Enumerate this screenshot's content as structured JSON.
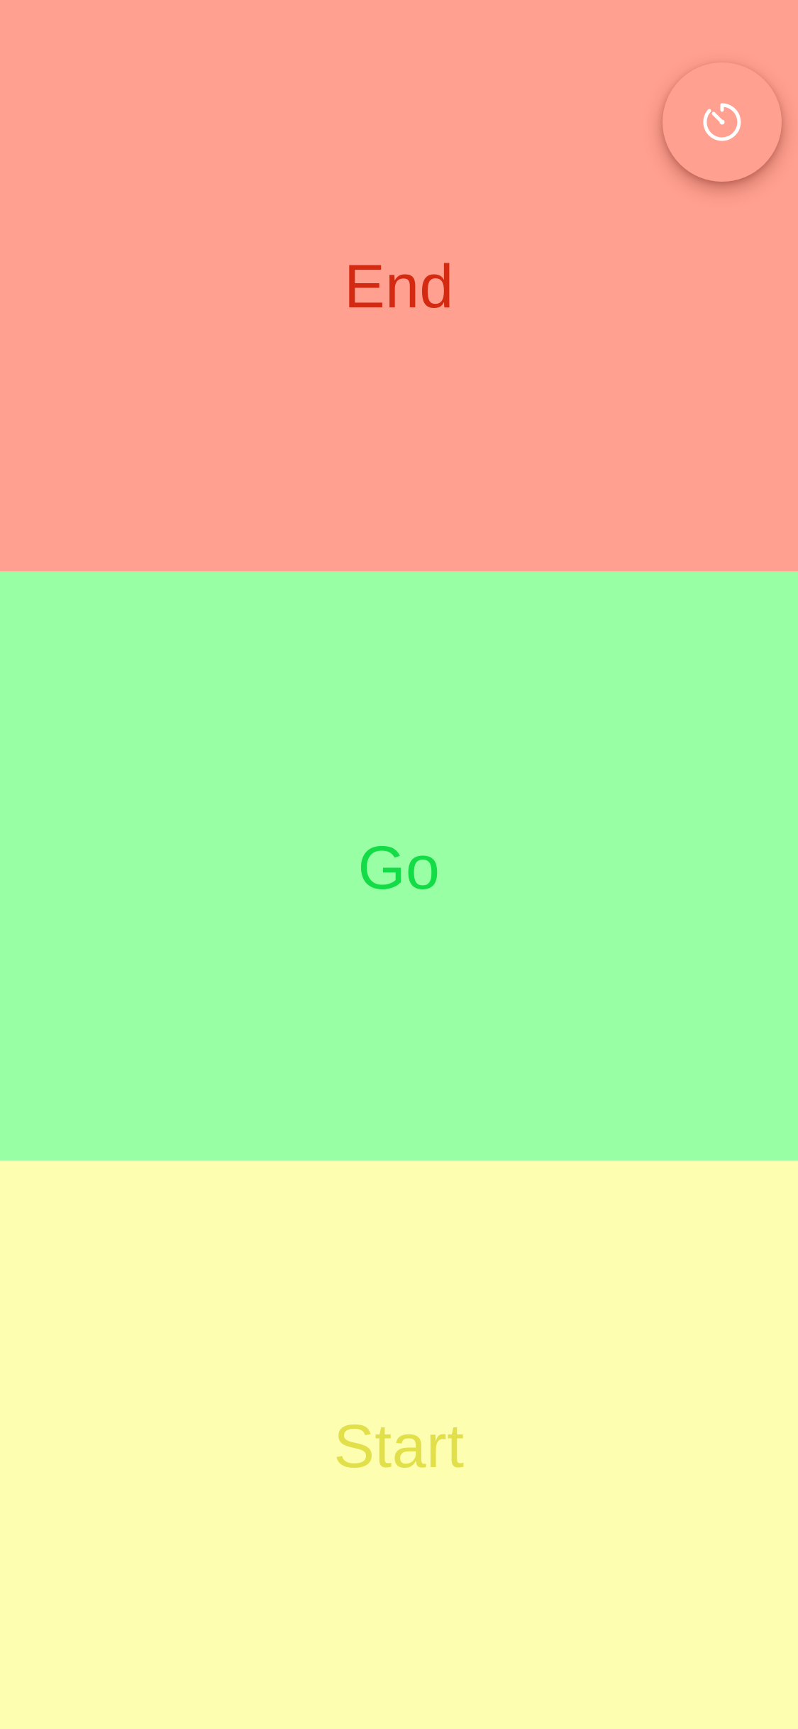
{
  "panels": {
    "end": {
      "label": "End",
      "background": "#FFA090",
      "text_color": "#D42A12"
    },
    "go": {
      "label": "Go",
      "background": "#99FFA4",
      "text_color": "#14DC46"
    },
    "start": {
      "label": "Start",
      "background": "#FDFEB0",
      "text_color": "#E2E04A"
    }
  },
  "timer_button": {
    "icon": "timer-icon",
    "background": "#FFA090",
    "icon_color": "#FFFFFF"
  }
}
